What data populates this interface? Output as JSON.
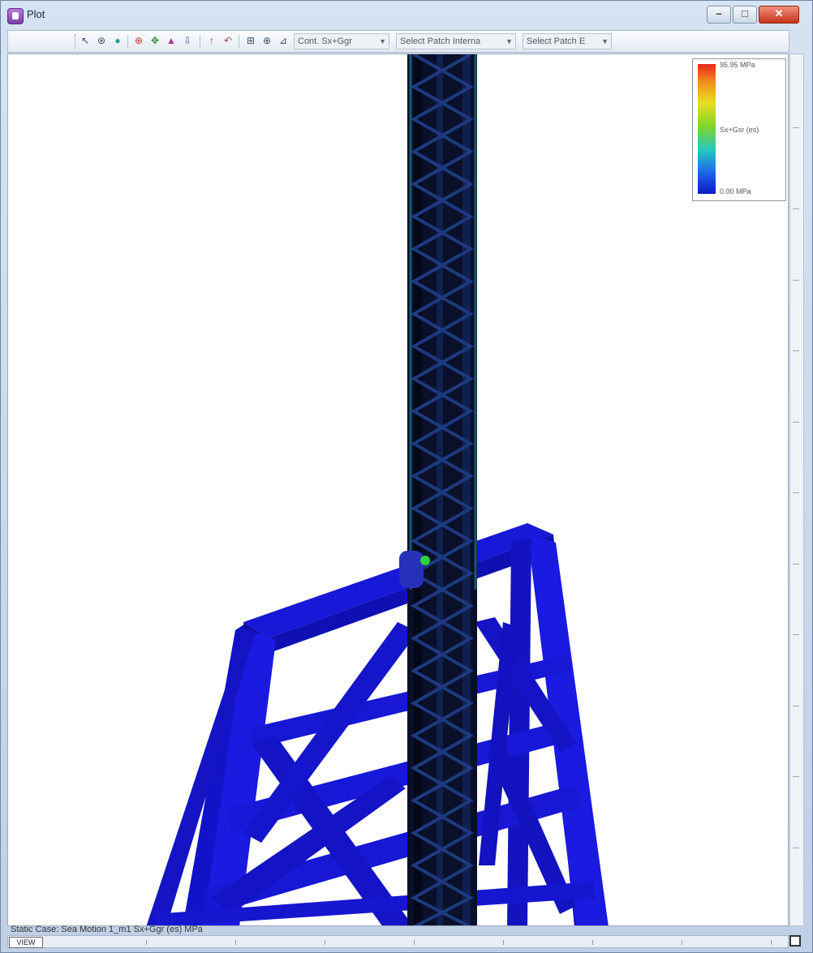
{
  "window": {
    "title": "Plot",
    "minimize_label": "–",
    "maximize_label": "□",
    "close_label": "✕"
  },
  "toolbar": {
    "combo_contour": "Cont. Sx+Ggr",
    "combo_patch_internal": "Select Patch Interna",
    "combo_patch_external": "Select Patch E"
  },
  "legend": {
    "max_label": "95.95 MPa",
    "mid_label": "Sx+Gsr (es)",
    "min_label": "0.00 MPa",
    "colors": [
      "#e8261c",
      "#f08f1e",
      "#e9de1f",
      "#7fd62a",
      "#25c9c0",
      "#1f6fe8",
      "#0b18c8"
    ]
  },
  "status": {
    "text": "Static Case: Sea Motion 1_m1 Sx+Ggr (es) MPa",
    "view_tab": "VIEW"
  },
  "icons": [
    "select-icon",
    "rotate-icon",
    "node-icon",
    "zoom-icon",
    "pan-icon",
    "export-icon",
    "print-icon",
    "up-icon",
    "undo-icon",
    "view-icon",
    "zoom-in-icon",
    "measure-icon"
  ],
  "model_colors": {
    "frame": "#1515d6",
    "frame_dark": "#0c0ca0",
    "mast": "#0a0f2a",
    "mast_brace": "#1b2d6e",
    "hotspot": "#30d040"
  }
}
